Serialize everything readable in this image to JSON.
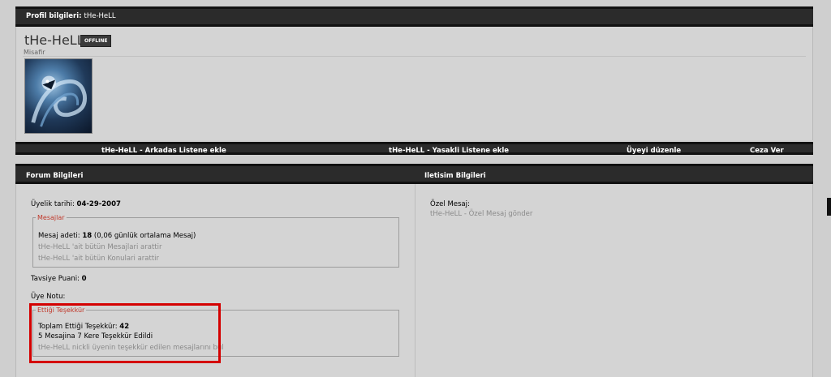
{
  "profile": {
    "header_label": "Profil bilgileri:",
    "header_name": "tHe-HeLL",
    "username": "tHe-HeLL",
    "status_badge": "OFFLINE",
    "rank": "Misafir"
  },
  "actions": {
    "add_friend": "tHe-HeLL - Arkadas Listene ekle",
    "add_ignore": "tHe-HeLL - Yasakli Listene ekle",
    "edit_user": "Üyeyi düzenle",
    "penalty": "Ceza Ver"
  },
  "sections": {
    "forum_info_title": "Forum Bilgileri",
    "contact_info_title": "Iletisim Bilgileri"
  },
  "forum": {
    "join_label": "Üyelik tarihi:",
    "join_date": "04-29-2007",
    "messages_legend": "Mesajlar",
    "post_count_label": "Mesaj adeti:",
    "post_count_value": "18",
    "post_count_note": "(0,06 günlük ortalama Mesaj)",
    "search_posts_link": "tHe-HeLL 'ait bütün Mesajlari arattir",
    "search_threads_link": "tHe-HeLL 'ait bütün Konulari arattir",
    "reputation_label": "Tavsiye Puani:",
    "reputation_value": "0",
    "member_note_label": "Üye Notu:",
    "thanks_legend": "Ettiği Teşekkür",
    "thanks_total_label": "Toplam Ettiği Teşekkür:",
    "thanks_total_value": "42",
    "thanks_received": "5 Mesajina 7 Kere Teşekkür Edildi",
    "thanks_search_link": "tHe-HeLL nickli üyenin teşekkür edilen mesajlarını bul"
  },
  "contact": {
    "pm_label": "Özel Mesaj:",
    "pm_link": "tHe-HeLL - Özel Mesaj gönder"
  },
  "colors": {
    "bar_background": "#2b2b2b",
    "page_background": "#cfcfcf",
    "legend_red": "#c0392b",
    "highlight_red": "#d40000"
  }
}
